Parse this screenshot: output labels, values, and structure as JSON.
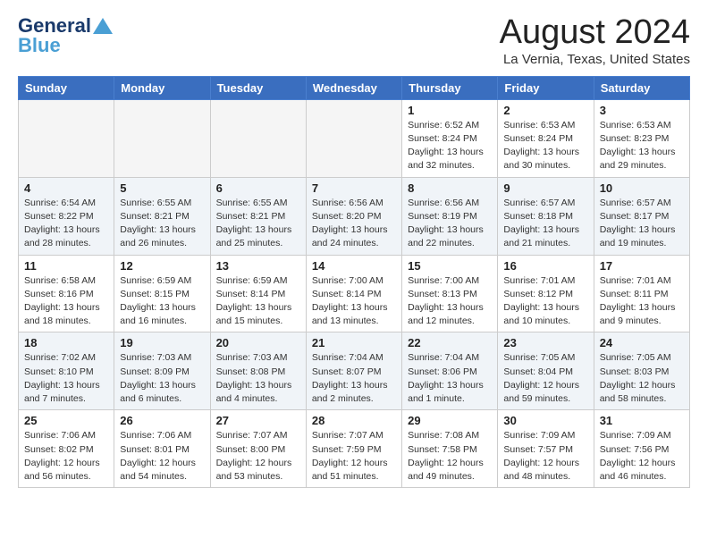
{
  "header": {
    "logo_general": "General",
    "logo_blue": "Blue",
    "title": "August 2024",
    "subtitle": "La Vernia, Texas, United States"
  },
  "days_of_week": [
    "Sunday",
    "Monday",
    "Tuesday",
    "Wednesday",
    "Thursday",
    "Friday",
    "Saturday"
  ],
  "weeks": [
    [
      {
        "day": "",
        "detail": ""
      },
      {
        "day": "",
        "detail": ""
      },
      {
        "day": "",
        "detail": ""
      },
      {
        "day": "",
        "detail": ""
      },
      {
        "day": "1",
        "detail": "Sunrise: 6:52 AM\nSunset: 8:24 PM\nDaylight: 13 hours\nand 32 minutes."
      },
      {
        "day": "2",
        "detail": "Sunrise: 6:53 AM\nSunset: 8:24 PM\nDaylight: 13 hours\nand 30 minutes."
      },
      {
        "day": "3",
        "detail": "Sunrise: 6:53 AM\nSunset: 8:23 PM\nDaylight: 13 hours\nand 29 minutes."
      }
    ],
    [
      {
        "day": "4",
        "detail": "Sunrise: 6:54 AM\nSunset: 8:22 PM\nDaylight: 13 hours\nand 28 minutes."
      },
      {
        "day": "5",
        "detail": "Sunrise: 6:55 AM\nSunset: 8:21 PM\nDaylight: 13 hours\nand 26 minutes."
      },
      {
        "day": "6",
        "detail": "Sunrise: 6:55 AM\nSunset: 8:21 PM\nDaylight: 13 hours\nand 25 minutes."
      },
      {
        "day": "7",
        "detail": "Sunrise: 6:56 AM\nSunset: 8:20 PM\nDaylight: 13 hours\nand 24 minutes."
      },
      {
        "day": "8",
        "detail": "Sunrise: 6:56 AM\nSunset: 8:19 PM\nDaylight: 13 hours\nand 22 minutes."
      },
      {
        "day": "9",
        "detail": "Sunrise: 6:57 AM\nSunset: 8:18 PM\nDaylight: 13 hours\nand 21 minutes."
      },
      {
        "day": "10",
        "detail": "Sunrise: 6:57 AM\nSunset: 8:17 PM\nDaylight: 13 hours\nand 19 minutes."
      }
    ],
    [
      {
        "day": "11",
        "detail": "Sunrise: 6:58 AM\nSunset: 8:16 PM\nDaylight: 13 hours\nand 18 minutes."
      },
      {
        "day": "12",
        "detail": "Sunrise: 6:59 AM\nSunset: 8:15 PM\nDaylight: 13 hours\nand 16 minutes."
      },
      {
        "day": "13",
        "detail": "Sunrise: 6:59 AM\nSunset: 8:14 PM\nDaylight: 13 hours\nand 15 minutes."
      },
      {
        "day": "14",
        "detail": "Sunrise: 7:00 AM\nSunset: 8:14 PM\nDaylight: 13 hours\nand 13 minutes."
      },
      {
        "day": "15",
        "detail": "Sunrise: 7:00 AM\nSunset: 8:13 PM\nDaylight: 13 hours\nand 12 minutes."
      },
      {
        "day": "16",
        "detail": "Sunrise: 7:01 AM\nSunset: 8:12 PM\nDaylight: 13 hours\nand 10 minutes."
      },
      {
        "day": "17",
        "detail": "Sunrise: 7:01 AM\nSunset: 8:11 PM\nDaylight: 13 hours\nand 9 minutes."
      }
    ],
    [
      {
        "day": "18",
        "detail": "Sunrise: 7:02 AM\nSunset: 8:10 PM\nDaylight: 13 hours\nand 7 minutes."
      },
      {
        "day": "19",
        "detail": "Sunrise: 7:03 AM\nSunset: 8:09 PM\nDaylight: 13 hours\nand 6 minutes."
      },
      {
        "day": "20",
        "detail": "Sunrise: 7:03 AM\nSunset: 8:08 PM\nDaylight: 13 hours\nand 4 minutes."
      },
      {
        "day": "21",
        "detail": "Sunrise: 7:04 AM\nSunset: 8:07 PM\nDaylight: 13 hours\nand 2 minutes."
      },
      {
        "day": "22",
        "detail": "Sunrise: 7:04 AM\nSunset: 8:06 PM\nDaylight: 13 hours\nand 1 minute."
      },
      {
        "day": "23",
        "detail": "Sunrise: 7:05 AM\nSunset: 8:04 PM\nDaylight: 12 hours\nand 59 minutes."
      },
      {
        "day": "24",
        "detail": "Sunrise: 7:05 AM\nSunset: 8:03 PM\nDaylight: 12 hours\nand 58 minutes."
      }
    ],
    [
      {
        "day": "25",
        "detail": "Sunrise: 7:06 AM\nSunset: 8:02 PM\nDaylight: 12 hours\nand 56 minutes."
      },
      {
        "day": "26",
        "detail": "Sunrise: 7:06 AM\nSunset: 8:01 PM\nDaylight: 12 hours\nand 54 minutes."
      },
      {
        "day": "27",
        "detail": "Sunrise: 7:07 AM\nSunset: 8:00 PM\nDaylight: 12 hours\nand 53 minutes."
      },
      {
        "day": "28",
        "detail": "Sunrise: 7:07 AM\nSunset: 7:59 PM\nDaylight: 12 hours\nand 51 minutes."
      },
      {
        "day": "29",
        "detail": "Sunrise: 7:08 AM\nSunset: 7:58 PM\nDaylight: 12 hours\nand 49 minutes."
      },
      {
        "day": "30",
        "detail": "Sunrise: 7:09 AM\nSunset: 7:57 PM\nDaylight: 12 hours\nand 48 minutes."
      },
      {
        "day": "31",
        "detail": "Sunrise: 7:09 AM\nSunset: 7:56 PM\nDaylight: 12 hours\nand 46 minutes."
      }
    ]
  ]
}
